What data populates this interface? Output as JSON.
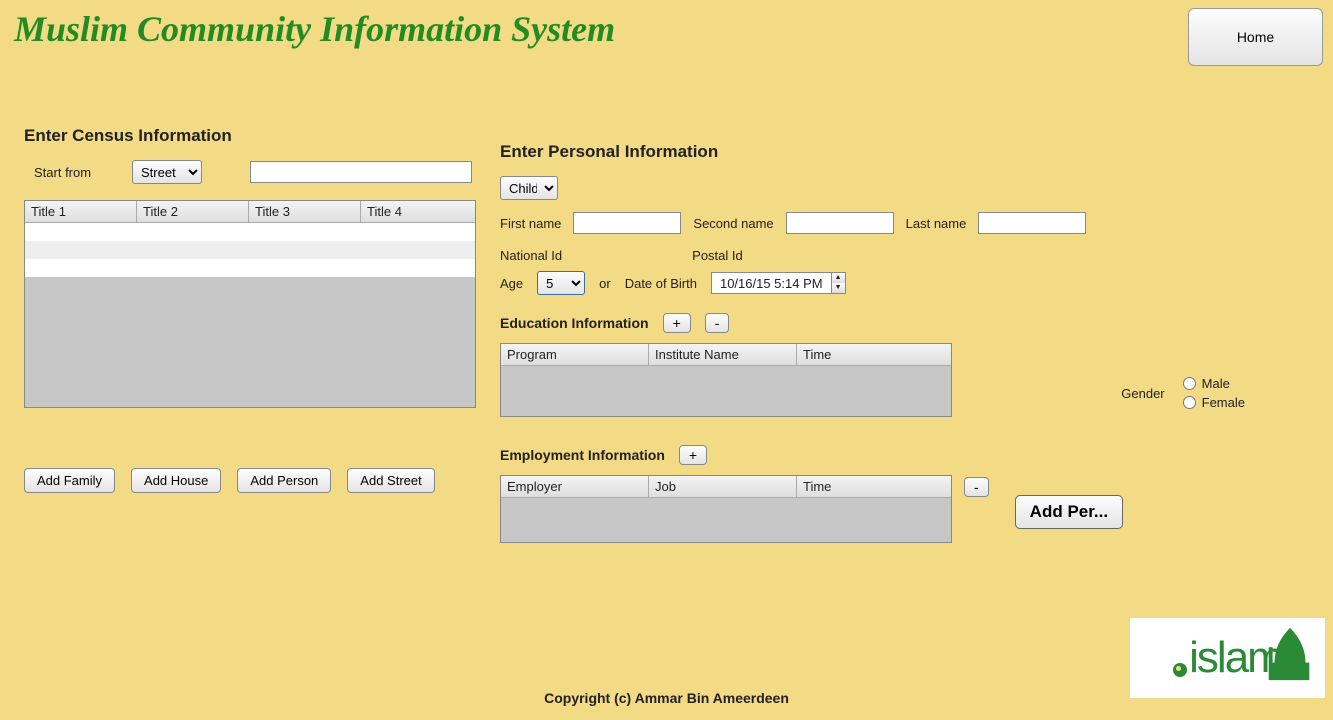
{
  "header": {
    "title": "Muslim Community Information System",
    "home": "Home"
  },
  "census": {
    "heading": "Enter Census Information",
    "start_from": "Start from",
    "combo_selected": "Street",
    "input_value": "",
    "cols": [
      "Title 1",
      "Title 2",
      "Title 3",
      "Title 4"
    ],
    "buttons": {
      "add_family": "Add Family",
      "add_house": "Add House",
      "add_person": "Add Person",
      "add_street": "Add Street"
    }
  },
  "personal": {
    "heading": "Enter Personal Information",
    "type_selected": "Child",
    "first_name": "First name",
    "second_name": "Second name",
    "last_name": "Last name",
    "national_id": "National Id",
    "postal_id": "Postal Id",
    "age": "Age",
    "age_value": "5",
    "or": "or",
    "dob": "Date of Birth",
    "dob_value": "10/16/15 5:14 PM",
    "education": {
      "heading": "Education Information",
      "cols": [
        "Program",
        "Institute Name",
        "Time"
      ]
    },
    "employment": {
      "heading": "Employment Information",
      "cols": [
        "Employer",
        "Job",
        "Time"
      ]
    },
    "gender": {
      "label": "Gender",
      "male": "Male",
      "female": "Female"
    },
    "plus": "+",
    "minus": "-",
    "add_per": "Add Per..."
  },
  "footer": {
    "copyright": "Copyright (c) Ammar Bin Ameerdeen"
  },
  "logo": {
    "text": "islam"
  }
}
